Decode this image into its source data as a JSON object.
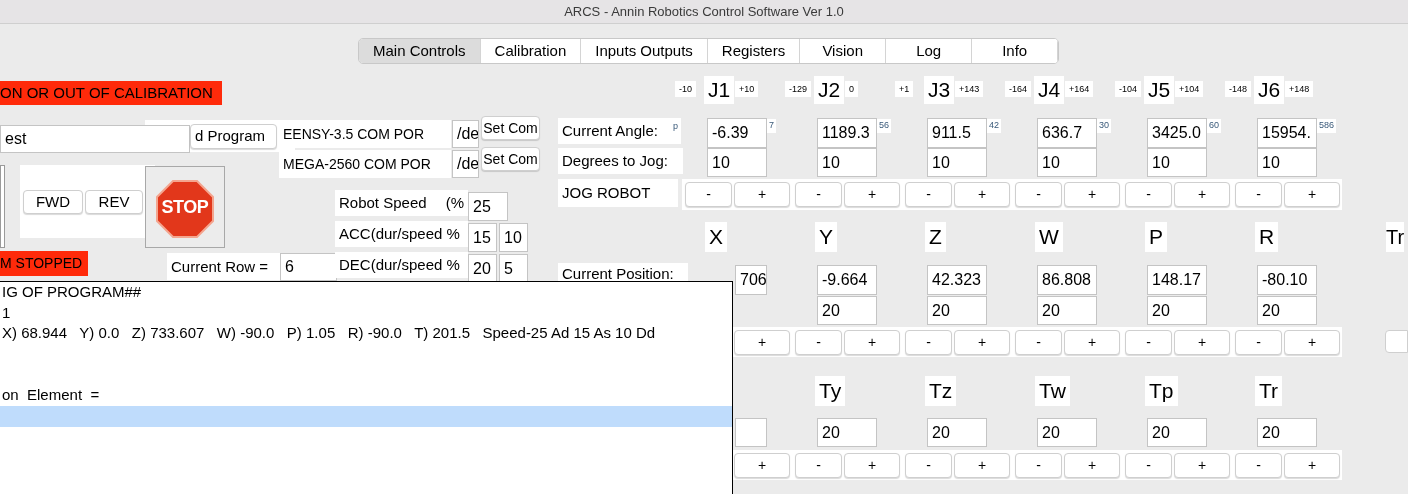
{
  "window": {
    "title": "ARCS - Annin Robotics Control Software Ver 1.0"
  },
  "tabs": [
    {
      "label": "Main Controls",
      "selected": true
    },
    {
      "label": "Calibration",
      "selected": false
    },
    {
      "label": "Inputs Outputs",
      "selected": false
    },
    {
      "label": "Registers",
      "selected": false
    },
    {
      "label": "Vision",
      "selected": false
    },
    {
      "label": "Log",
      "selected": false
    },
    {
      "label": "Info",
      "selected": false
    }
  ],
  "status": {
    "calibration_banner": "ON OR OUT OF CALIBRATION",
    "run_state": "M STOPPED"
  },
  "program": {
    "name": "est",
    "load_button": "d Program",
    "fwd_button": "FWD",
    "rev_button": "REV",
    "stop_button": "STOP",
    "current_row_label": "Current Row  =",
    "current_row": "6",
    "rows": [
      {
        "text": "IG OF PROGRAM##",
        "selected": false
      },
      {
        "text": "1",
        "selected": false
      },
      {
        "text": "X) 68.944   Y) 0.0   Z) 733.607   W) -90.0   P) 1.05   R) -90.0   T) 201.5   Speed-25 Ad 15 As 10 Dd",
        "selected": false
      },
      {
        "selected": false
      },
      {
        "selected": false
      },
      {
        "text": "on  Element  =",
        "selected": false
      },
      {
        "selected": true
      }
    ]
  },
  "com_ports": [
    {
      "label": "EENSY-3.5 COM POR",
      "value": "/de",
      "button": "Set Com"
    },
    {
      "label": "MEGA-2560 COM POR",
      "value": "/de",
      "button": "Set Com"
    }
  ],
  "speed": [
    {
      "label": "Robot Speed",
      "unit": "(%",
      "values": [
        "25"
      ]
    },
    {
      "label": "ACC(dur/speed %",
      "values": [
        "15",
        "10"
      ]
    },
    {
      "label": "DEC(dur/speed %",
      "values": [
        "20",
        "5"
      ]
    }
  ],
  "joints": {
    "current_angle_label": "Current Angle:",
    "current_angle_fragment": "p",
    "jog_label": "Degrees to Jog:",
    "jog_robot_label": "JOG ROBOT",
    "items": [
      {
        "name": "J1",
        "min": "-10",
        "max": "+10",
        "angle": "-6.39",
        "fragment": "7",
        "jog": "10",
        "buttons": [
          "-",
          "+"
        ]
      },
      {
        "name": "J2",
        "min": "-129",
        "max": "0",
        "angle": "1189.3",
        "fragment": "56",
        "jog": "10",
        "buttons": [
          "-",
          "+"
        ]
      },
      {
        "name": "J3",
        "min": "+1",
        "max": "+143",
        "angle": "911.5",
        "fragment": "42",
        "jog": "10",
        "buttons": [
          "-",
          "+"
        ]
      },
      {
        "name": "J4",
        "min": "-164",
        "max": "+164",
        "angle": "636.7",
        "fragment": "30",
        "jog": "10",
        "buttons": [
          "-",
          "+"
        ]
      },
      {
        "name": "J5",
        "min": "-104",
        "max": "+104",
        "angle": "3425.0",
        "fragment": "60",
        "jog": "10",
        "buttons": [
          "-",
          "+"
        ]
      },
      {
        "name": "J6",
        "min": "-148",
        "max": "+148",
        "angle": "15954.",
        "fragment": "586",
        "jog": "10",
        "buttons": [
          "-",
          "+"
        ]
      }
    ]
  },
  "cartesian": {
    "current_position_label": "Current Position:",
    "cut_label": "Tr",
    "items": [
      {
        "name": "X",
        "value": "706",
        "buttons": [
          "+"
        ]
      },
      {
        "name": "Y",
        "value": "-9.664",
        "step": "20",
        "buttons": [
          "-",
          "+"
        ]
      },
      {
        "name": "Z",
        "value": "42.323",
        "step": "20",
        "buttons": [
          "-",
          "+"
        ]
      },
      {
        "name": "W",
        "value": "86.808",
        "step": "20",
        "buttons": [
          "-",
          "+"
        ]
      },
      {
        "name": "P",
        "value": "148.17",
        "step": "20",
        "buttons": [
          "-",
          "+"
        ]
      },
      {
        "name": "R",
        "value": "-80.10",
        "step": "20",
        "buttons": [
          "-",
          "+"
        ]
      }
    ]
  },
  "tool": {
    "items": [
      {
        "buttons": [
          "+"
        ]
      },
      {
        "name": "Ty",
        "step": "20",
        "buttons": [
          "-",
          "+"
        ]
      },
      {
        "name": "Tz",
        "step": "20",
        "buttons": [
          "-",
          "+"
        ]
      },
      {
        "name": "Tw",
        "step": "20",
        "buttons": [
          "-",
          "+"
        ]
      },
      {
        "name": "Tp",
        "step": "20",
        "buttons": [
          "-",
          "+"
        ]
      },
      {
        "name": "Tr",
        "step": "20",
        "buttons": [
          "-",
          "+"
        ]
      }
    ]
  }
}
